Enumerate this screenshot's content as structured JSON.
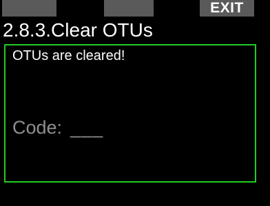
{
  "softkeys": {
    "left": "",
    "middle": "",
    "right": "EXIT"
  },
  "screen": {
    "title": "2.8.3.Clear OTUs",
    "message": "OTUs are cleared!",
    "code_label": "Code:",
    "code_value": "___"
  },
  "colors": {
    "background": "#000000",
    "softkey_bg": "#5a5a5a",
    "panel_border": "#22cc22",
    "code_text": "#8f8f8f"
  }
}
